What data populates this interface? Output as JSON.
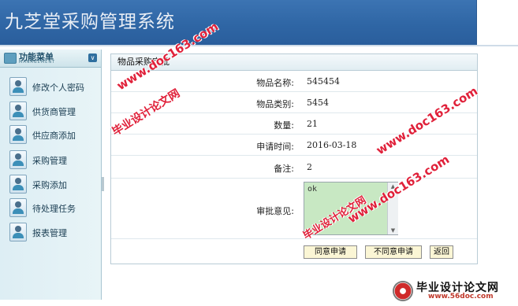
{
  "app": {
    "title": "九芝堂采购管理系统"
  },
  "sidebar": {
    "header": {
      "title": "功能菜单",
      "subtitle": "MANAGEMENT"
    },
    "items": [
      {
        "label": "修改个人密码",
        "icon": "user-card-icon"
      },
      {
        "label": "供货商管理",
        "icon": "user-card-icon"
      },
      {
        "label": "供应商添加",
        "icon": "user-card-icon"
      },
      {
        "label": "采购管理",
        "icon": "user-card-icon"
      },
      {
        "label": "采购添加",
        "icon": "user-card-icon"
      },
      {
        "label": "待处理任务",
        "icon": "user-card-icon"
      },
      {
        "label": "报表管理",
        "icon": "user-card-icon"
      }
    ]
  },
  "panel": {
    "title": "物品采购审批",
    "fields": [
      {
        "label": "物品名称:",
        "value": "545454"
      },
      {
        "label": "物品类别:",
        "value": "5454"
      },
      {
        "label": "数量:",
        "value": "21"
      },
      {
        "label": "申请时间:",
        "value": "2016-03-18"
      },
      {
        "label": "备注:",
        "value": "2"
      }
    ],
    "opinion": {
      "label": "审批意见:",
      "value": "ok"
    },
    "buttons": {
      "approve": "同意申请",
      "reject": "不同意申请",
      "back": "返回"
    }
  },
  "watermarks": {
    "site": "www.doc163.com",
    "cn": "毕业设计论文网",
    "logo_cn": "毕业设计论文网",
    "logo_url": "www.56doc.com"
  },
  "colors": {
    "header": "#2f66a5",
    "sidebar": "#e3f1f5",
    "opinion_bg": "#c8e8c3",
    "button_bg": "#fbf6d5",
    "watermark": "#e0213a"
  }
}
